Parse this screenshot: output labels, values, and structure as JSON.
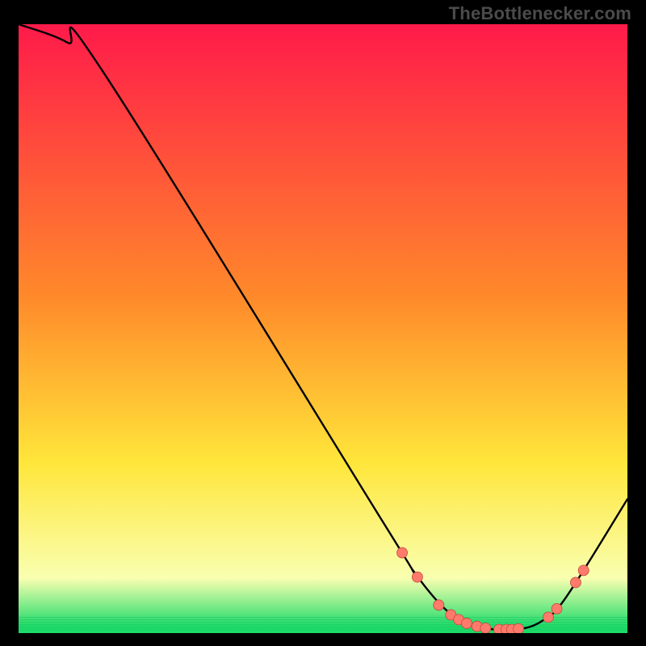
{
  "watermark": "TheBottlenecker.com",
  "colors": {
    "curve": "#000000",
    "marker_fill": "#ff7a6b",
    "marker_stroke": "#c24a3e",
    "grad_top": "#ff1a4a",
    "grad_mid1": "#ff8a2a",
    "grad_mid2": "#ffe63a",
    "grad_low": "#f9ffb0",
    "grad_base": "#1ddb6a"
  },
  "chart_data": {
    "type": "line",
    "title": "",
    "xlabel": "",
    "ylabel": "",
    "xlim": [
      0,
      100
    ],
    "ylim": [
      0,
      100
    ],
    "curve": [
      {
        "x": 0,
        "y": 100
      },
      {
        "x": 8,
        "y": 97
      },
      {
        "x": 14,
        "y": 92
      },
      {
        "x": 60,
        "y": 18
      },
      {
        "x": 65,
        "y": 10
      },
      {
        "x": 70,
        "y": 4
      },
      {
        "x": 74,
        "y": 1.5
      },
      {
        "x": 78,
        "y": 0.6
      },
      {
        "x": 82,
        "y": 0.6
      },
      {
        "x": 86,
        "y": 2
      },
      {
        "x": 90,
        "y": 6
      },
      {
        "x": 100,
        "y": 22
      }
    ],
    "markers": [
      {
        "x": 63,
        "y": 13.2
      },
      {
        "x": 65.5,
        "y": 9.2
      },
      {
        "x": 69,
        "y": 4.6
      },
      {
        "x": 71,
        "y": 3.0
      },
      {
        "x": 72.3,
        "y": 2.2
      },
      {
        "x": 73.6,
        "y": 1.6
      },
      {
        "x": 75.3,
        "y": 1.1
      },
      {
        "x": 76.7,
        "y": 0.8
      },
      {
        "x": 78.9,
        "y": 0.6
      },
      {
        "x": 80.1,
        "y": 0.6
      },
      {
        "x": 81,
        "y": 0.6
      },
      {
        "x": 82.1,
        "y": 0.7
      },
      {
        "x": 87,
        "y": 2.6
      },
      {
        "x": 88.4,
        "y": 4.0
      },
      {
        "x": 91.5,
        "y": 8.3
      },
      {
        "x": 92.8,
        "y": 10.3
      }
    ]
  }
}
